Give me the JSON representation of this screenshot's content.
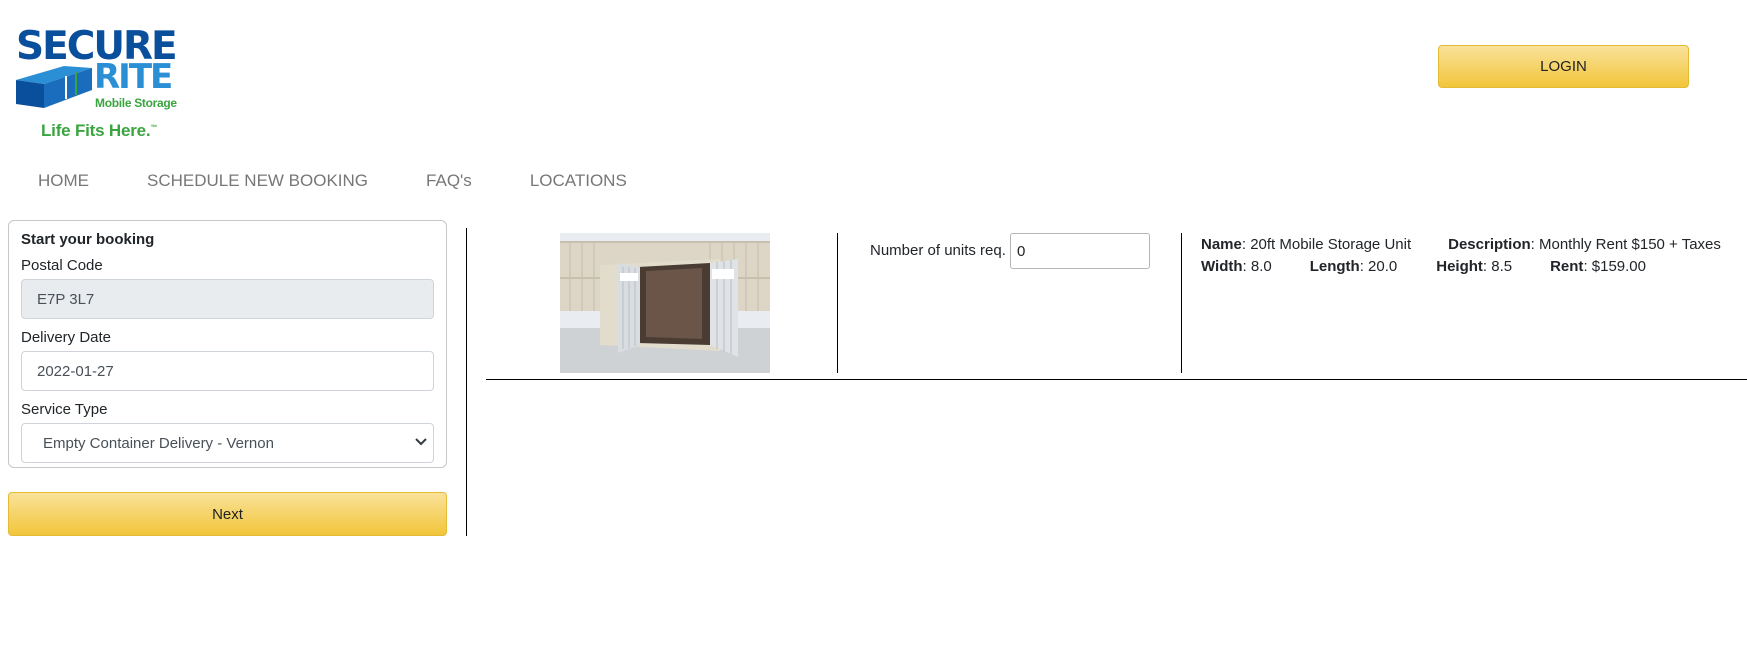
{
  "logo": {
    "line1": "SECURE",
    "line2": "RITE",
    "line3": "Mobile Storage",
    "tagline": "Life Fits Here.",
    "tagline_mark": "™"
  },
  "header": {
    "login_label": "LOGIN"
  },
  "nav": {
    "items": [
      {
        "label": "HOME"
      },
      {
        "label": "SCHEDULE NEW BOOKING"
      },
      {
        "label": "FAQ's"
      },
      {
        "label": "LOCATIONS"
      }
    ]
  },
  "booking": {
    "title": "Start your booking",
    "postal_label": "Postal Code",
    "postal_value": "E7P 3L7",
    "date_label": "Delivery Date",
    "date_value": "2022-01-27",
    "service_label": "Service Type",
    "service_value": "Empty Container Delivery - Vernon",
    "next_label": "Next"
  },
  "product": {
    "image_icon": "storage-container-image",
    "units_label": "Number of units req.",
    "units_value": "0",
    "name_key": "Name",
    "name_value": ": 20ft Mobile Storage Unit",
    "description_key": "Description",
    "description_value": ": Monthly Rent $150 + Taxes",
    "width_key": "Width",
    "width_value": ": 8.0",
    "length_key": "Length",
    "length_value": ": 20.0",
    "height_key": "Height",
    "height_value": ": 8.5",
    "rent_key": "Rent",
    "rent_value": ": $159.00"
  },
  "colors": {
    "brand_blue": "#0a4f9c",
    "brand_light_blue": "#2b8fd6",
    "brand_green": "#3aa53f",
    "button_yellow": "#f2c53a"
  }
}
